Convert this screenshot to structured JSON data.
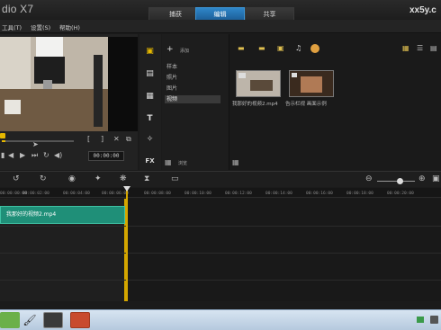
{
  "app": {
    "title": "dio X7",
    "brand": "xx5y.c"
  },
  "tabs": [
    {
      "label": "捕获",
      "active": false
    },
    {
      "label": "编辑",
      "active": true
    },
    {
      "label": "共享",
      "active": false
    }
  ],
  "menu": [
    "工具(T)",
    "设置(S)",
    "帮助(H)"
  ],
  "player": {
    "timecode": "00:00:00"
  },
  "library": {
    "add_label": "添加",
    "folders": [
      "样本",
      "照片",
      "图片",
      "视频"
    ],
    "active_folder": 3,
    "browse_label": "浏览",
    "media": [
      {
        "label": "我那好的视频2.mp4"
      },
      {
        "label": "告示栏视 画面示例"
      }
    ]
  },
  "timeline": {
    "ticks": [
      "00:00:00:00",
      "00:00:02:00",
      "00:00:04:00",
      "00:00:06:00",
      "00:00:08:00",
      "00:00:10:00",
      "00:00:12:00",
      "00:00:14:00",
      "00:00:16:00",
      "00:00:18:00",
      "00:00:20:00"
    ],
    "clip_label": "我那好的视频2.mp4"
  },
  "colors": {
    "accent": "#2f87c9",
    "clip": "#1f8f78",
    "playhead": "#d4a600"
  }
}
